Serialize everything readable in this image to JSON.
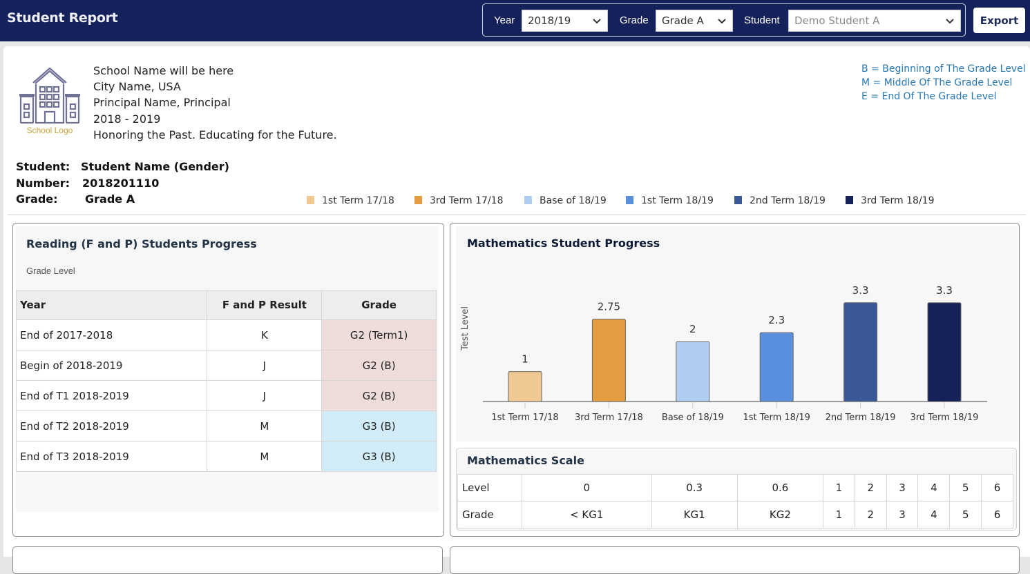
{
  "header": {
    "title": "Student Report",
    "filters": {
      "year": {
        "label": "Year",
        "value": "2018/19"
      },
      "grade": {
        "label": "Grade",
        "value": "Grade A"
      },
      "student": {
        "label": "Student",
        "value": "Demo Student A"
      }
    },
    "export_label": "Export"
  },
  "school": {
    "logo_label": "School Logo",
    "lines": [
      "School Name will be here",
      "City Name, USA",
      "Principal Name, Principal",
      "2018 - 2019",
      "Honoring the Past. Educating for the Future."
    ]
  },
  "grade_key": [
    "B = Beginning of The Grade Level",
    "M = Middle Of The Grade Level",
    "E = End Of The Grade Level"
  ],
  "student": {
    "name_label": "Student:",
    "name": "Student Name (Gender)",
    "number_label": "Number:",
    "number": "2018201110",
    "grade_label": "Grade:",
    "grade": "Grade A"
  },
  "legend": [
    {
      "label": "1st Term 17/18",
      "color": "#f0c892"
    },
    {
      "label": "3rd Term 17/18",
      "color": "#e39c40"
    },
    {
      "label": "Base of 18/19",
      "color": "#aecdf0"
    },
    {
      "label": "1st Term 18/19",
      "color": "#5a8fde"
    },
    {
      "label": "2nd Term 18/19",
      "color": "#3b5998"
    },
    {
      "label": "3rd Term 18/19",
      "color": "#16215a"
    }
  ],
  "reading": {
    "title": "Reading (F and P) Students Progress",
    "subtitle": "Grade Level",
    "columns": [
      "Year",
      "F and P Result",
      "Grade"
    ],
    "rows": [
      {
        "year": "End of 2017-2018",
        "result": "K",
        "grade": "G2 (Term1)",
        "tone": "below"
      },
      {
        "year": "Begin of 2018-2019",
        "result": "J",
        "grade": "G2 (B)",
        "tone": "below"
      },
      {
        "year": "End of T1 2018-2019",
        "result": "J",
        "grade": "G2 (B)",
        "tone": "below"
      },
      {
        "year": "End of T2 2018-2019",
        "result": "M",
        "grade": "G3 (B)",
        "tone": "on"
      },
      {
        "year": "End of T3 2018-2019",
        "result": "M",
        "grade": "G3 (B)",
        "tone": "on"
      }
    ],
    "tone_colors": {
      "below": "#eddcda",
      "on": "#d1ecf6"
    }
  },
  "chart_data": {
    "type": "bar",
    "title": "Mathematics Student Progress",
    "xlabel": "",
    "ylabel": "Test Level",
    "categories": [
      "1st Term 17/18",
      "3rd Term 17/18",
      "Base of 18/19",
      "1st Term 18/19",
      "2nd Term 18/19",
      "3rd Term 18/19"
    ],
    "values": [
      1,
      2.75,
      2,
      2.3,
      3.3,
      3.3
    ],
    "data_labels": [
      "1",
      "2.75",
      "2",
      "2.3",
      "3.3",
      "3.3"
    ],
    "colors": [
      "#f0c892",
      "#e39c40",
      "#aecdf0",
      "#5a8fde",
      "#3b5998",
      "#16215a"
    ],
    "ylim": [
      0,
      3.3
    ],
    "grid": false,
    "legend": "top (shared legend above panels)"
  },
  "math_scale": {
    "title": "Mathematics Scale",
    "level_label": "Level",
    "levels": [
      "0",
      "0.3",
      "0.6",
      "1",
      "2",
      "3",
      "4",
      "5",
      "6"
    ],
    "grade_label": "Grade",
    "grades": [
      "< KG1",
      "KG1",
      "KG2",
      "1",
      "2",
      "3",
      "4",
      "5",
      "6"
    ]
  }
}
